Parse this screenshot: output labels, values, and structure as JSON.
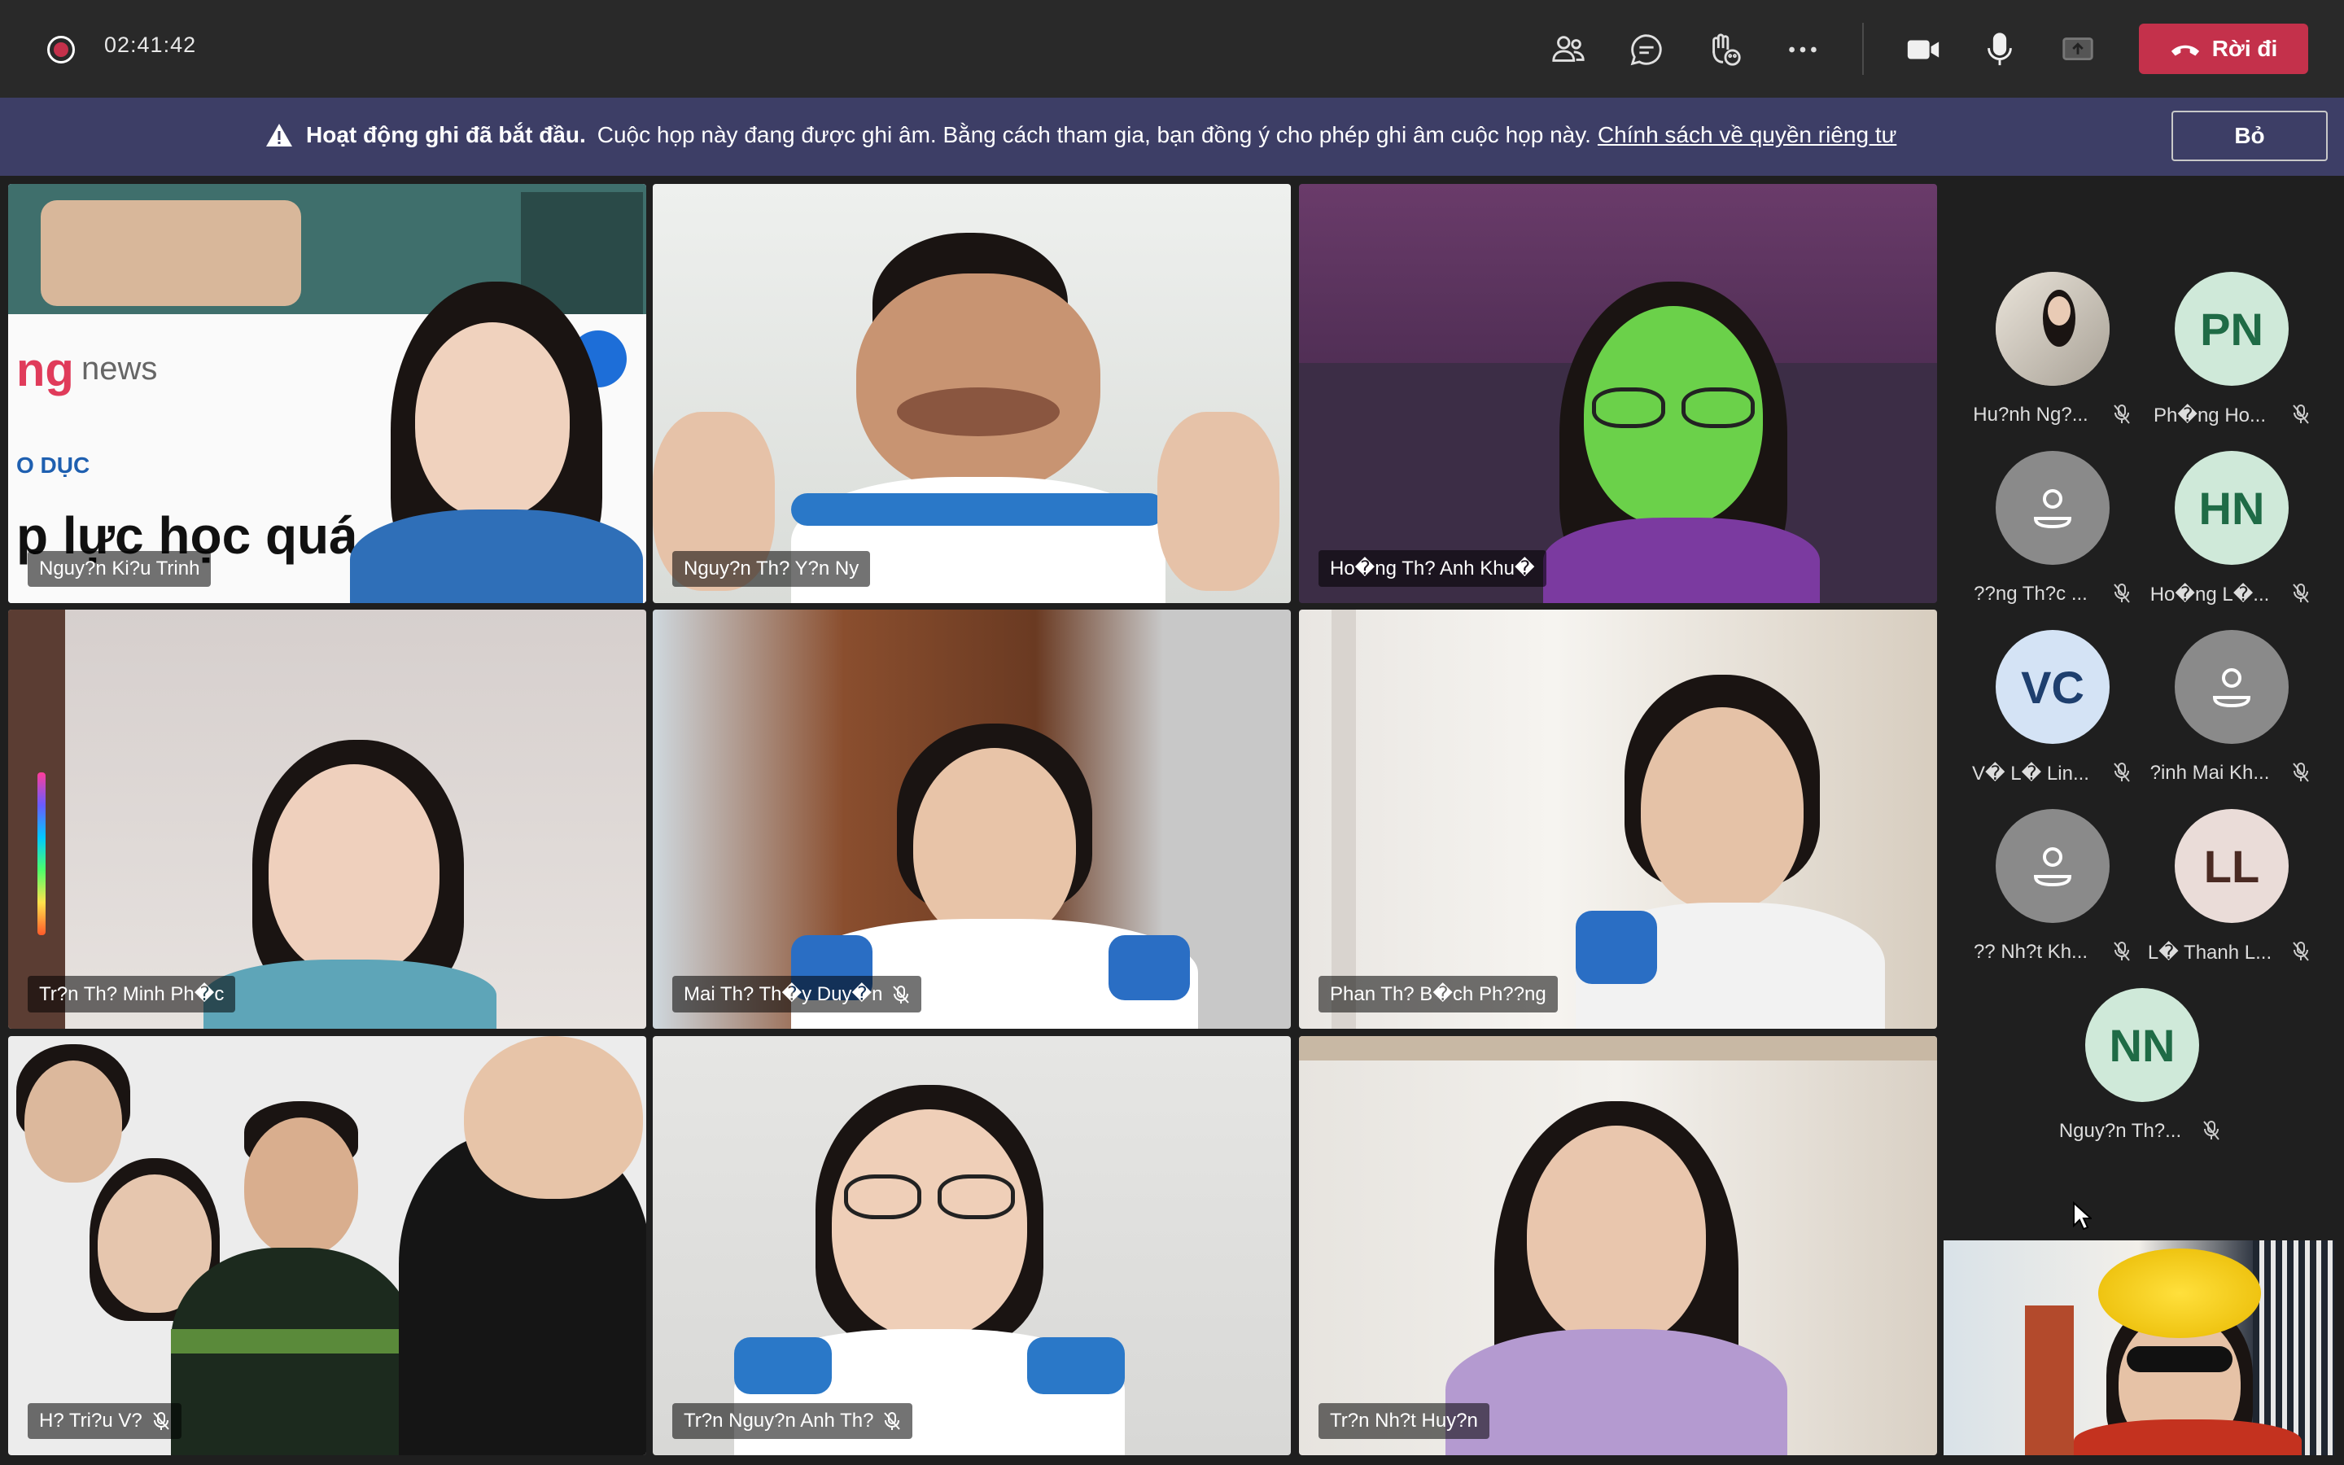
{
  "call": {
    "timer": "02:41:42",
    "leave_label": "Rời đi",
    "toolbar_icons": [
      "people-icon",
      "chat-icon",
      "reactions-icon",
      "more-icon",
      "camera-icon",
      "mic-icon",
      "share-icon"
    ]
  },
  "banner": {
    "title": "Hoạt động ghi đã bắt đầu.",
    "message": "Cuộc họp này đang được ghi âm. Bằng cách tham gia, bạn đồng ý cho phép ghi âm cuộc họp này.",
    "link": "Chính sách về quyền riêng tư",
    "dismiss_label": "Bỏ"
  },
  "video_tiles": [
    {
      "name": "Nguy?n Ki?u Trinh",
      "muted": false,
      "active": true,
      "overlay_text_1": "ng",
      "overlay_text_2": "news",
      "overlay_text_3": "O DỤC",
      "overlay_text_4": "p lực học quá"
    },
    {
      "name": "Nguy?n Th? Y?n Ny",
      "muted": false
    },
    {
      "name": "Ho�ng Th? Anh Khu�",
      "muted": false
    },
    {
      "name": "Tr?n Th? Minh Ph�c",
      "muted": false
    },
    {
      "name": "Mai Th? Th�y Duy�n",
      "muted": true
    },
    {
      "name": "Phan Th? B�ch Ph??ng",
      "muted": false
    },
    {
      "name": "H? Tri?u V?",
      "muted": true
    },
    {
      "name": "Tr?n Nguy?n Anh Th?",
      "muted": true
    },
    {
      "name": "Tr?n Nh?t Huy?n",
      "muted": false
    }
  ],
  "participants": [
    {
      "name": "Hu?nh Ng?...",
      "initials": "",
      "type": "photo",
      "bg": "#d9d2c8",
      "fg": "#1f1f1f",
      "muted": true
    },
    {
      "name": "Ph�ng Ho...",
      "initials": "PN",
      "type": "initials",
      "bg": "#cfe9d9",
      "fg": "#1f6b46",
      "muted": true
    },
    {
      "name": "??ng Th?c ...",
      "initials": "",
      "type": "generic",
      "bg": "#8a8a8a",
      "fg": "#ffffff",
      "muted": true
    },
    {
      "name": "Ho�ng L�...",
      "initials": "HN",
      "type": "initials",
      "bg": "#cfe9d9",
      "fg": "#1f6b46",
      "muted": true
    },
    {
      "name": "V� L� Lin...",
      "initials": "VC",
      "type": "initials",
      "bg": "#d4e3f5",
      "fg": "#1e3f6e",
      "muted": true
    },
    {
      "name": "?inh Mai Kh...",
      "initials": "",
      "type": "generic",
      "bg": "#8a8a8a",
      "fg": "#ffffff",
      "muted": true
    },
    {
      "name": "?? Nh?t Kh...",
      "initials": "",
      "type": "generic",
      "bg": "#8a8a8a",
      "fg": "#ffffff",
      "muted": true
    },
    {
      "name": "L� Thanh L...",
      "initials": "LL",
      "type": "initials",
      "bg": "#eadcd8",
      "fg": "#4a2a22",
      "muted": true
    },
    {
      "name": "Nguy?n Th?...",
      "initials": "NN",
      "type": "initials",
      "bg": "#cfe9d9",
      "fg": "#1f6b46",
      "muted": true
    }
  ],
  "colors": {
    "accent": "#7f85f5",
    "leave": "#c4314b",
    "banner": "#3d3e66",
    "topbar": "#292929"
  }
}
